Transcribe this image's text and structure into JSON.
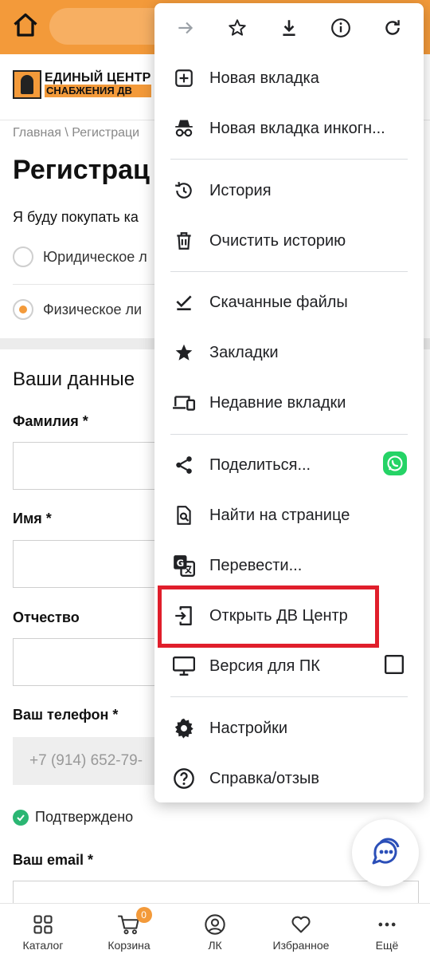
{
  "site": {
    "logo_line1": "ЕДИНЫЙ ЦЕНТР",
    "logo_line2": "СНАБЖЕНИЯ ДВ",
    "breadcrumb": "Главная \\  Регистраци",
    "page_title": "Регистрац",
    "buyer_question": "Я буду покупать ка",
    "radio_legal": "Юридическое л",
    "radio_person": "Физическое ли",
    "section_title": "Ваши данные",
    "label_lastname": "Фамилия *",
    "label_firstname": "Имя *",
    "label_patronymic": "Отчество",
    "label_phone": "Ваш телефон *",
    "phone_value": "+7 (914) 652-79-",
    "confirmed": "Подтверждено",
    "label_email": "Ваш email *"
  },
  "bottom_nav": {
    "catalog": "Каталог",
    "cart": "Корзина",
    "cart_badge": "0",
    "account": "ЛК",
    "favorites": "Избранное",
    "more": "Ещё"
  },
  "menu": {
    "toolbar": [
      "forward-icon",
      "star-icon",
      "download-icon",
      "info-icon",
      "refresh-icon"
    ],
    "items": [
      {
        "label": "Новая вкладка",
        "icon": "new-tab-icon"
      },
      {
        "label": "Новая вкладка инкогн...",
        "icon": "incognito-icon"
      },
      {
        "label": "История",
        "icon": "history-icon"
      },
      {
        "label": "Очистить историю",
        "icon": "trash-icon"
      },
      {
        "label": "Скачанные файлы",
        "icon": "downloads-icon"
      },
      {
        "label": "Закладки",
        "icon": "bookmark-star-icon"
      },
      {
        "label": "Недавние вкладки",
        "icon": "devices-icon"
      },
      {
        "label": "Поделиться...",
        "icon": "share-icon"
      },
      {
        "label": "Найти на странице",
        "icon": "find-in-page-icon"
      },
      {
        "label": "Перевести...",
        "icon": "translate-icon"
      },
      {
        "label": "Открыть ДВ Центр",
        "icon": "open-app-icon"
      },
      {
        "label": "Версия для ПК",
        "icon": "desktop-icon"
      },
      {
        "label": "Настройки",
        "icon": "gear-icon"
      },
      {
        "label": "Справка/отзыв",
        "icon": "help-icon"
      }
    ]
  },
  "colors": {
    "brand_orange": "#f39a3a",
    "highlight_red": "#e01e2b",
    "confirm_green": "#2bb673",
    "whatsapp_green": "#25d366",
    "chat_blue": "#2b4fb8"
  }
}
